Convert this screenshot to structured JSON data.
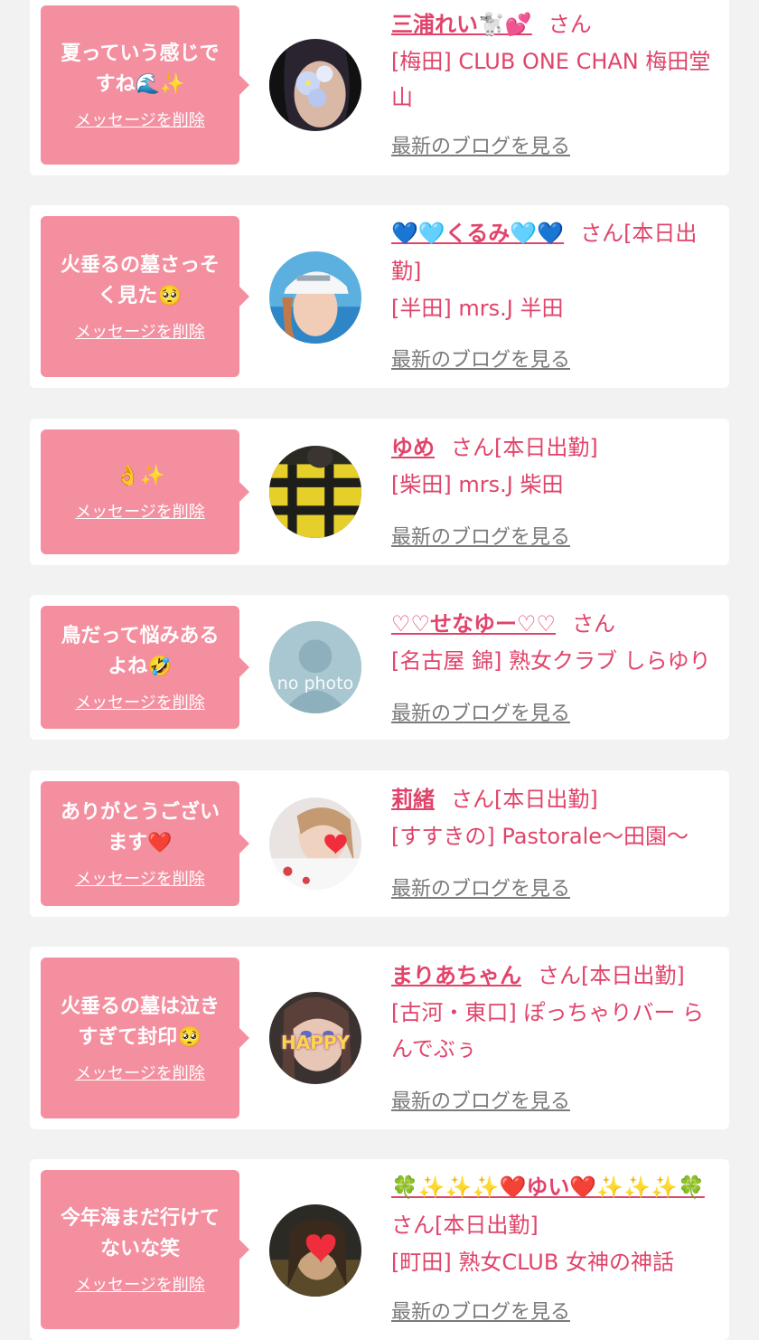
{
  "delete_label": "メッセージを削除",
  "blog_label": "最新のブログを見る",
  "honorific": "さん",
  "entries": [
    {
      "message": "夏っていう感じですね🌊✨",
      "name": "三浦れい🐩💕",
      "suffix": "",
      "shop": "[梅田] CLUB ONE CHAN 梅田堂山",
      "avatar_icon": "woman-with-flowers-photo"
    },
    {
      "message": "火垂るの墓さっそく見た🥺",
      "name": "💙🩵くるみ🩵💙",
      "suffix": "[本日出勤]",
      "shop": "[半田] mrs.J 半田",
      "avatar_icon": "woman-with-cap-photo"
    },
    {
      "message": "👌✨",
      "name": "ゆめ",
      "suffix": "[本日出勤]",
      "shop": "[柴田] mrs.J 柴田",
      "avatar_icon": "plaid-shirt-photo"
    },
    {
      "message": "鳥だって悩みあるよね🤣",
      "name": "♡♡せなゆー♡♡",
      "suffix": "",
      "shop": "[名古屋 錦] 熟女クラブ しらゆり",
      "avatar_icon": "no-photo-placeholder",
      "avatar_text": "no photo"
    },
    {
      "message": "ありがとうございます❤️",
      "name": "莉緒",
      "suffix": "[本日出勤]",
      "shop": "[すすきの] Pastorale〜田園〜",
      "avatar_icon": "woman-with-heart-photo"
    },
    {
      "message": "火垂るの墓は泣きすぎて封印🥺",
      "name": "まりあちゃん",
      "suffix": "[本日出勤]",
      "shop": "[古河・東口] ぽっちゃりバー らんでぶぅ",
      "avatar_icon": "woman-happy-sticker-photo",
      "avatar_text": "HAPPY"
    },
    {
      "message": "今年海まだ行けてないな笑",
      "name": "🍀✨✨✨❤️ゆい❤️✨✨✨🍀",
      "suffix": "[本日出勤]",
      "shop": "[町田] 熟女CLUB 女神の神話",
      "avatar_icon": "woman-with-heart-photo"
    }
  ],
  "colors": {
    "background": "#f2f2f2",
    "card": "#ffffff",
    "bubble": "#f48fa0",
    "accent_pink": "#e0446a",
    "link_gray": "#7a7a7a"
  }
}
